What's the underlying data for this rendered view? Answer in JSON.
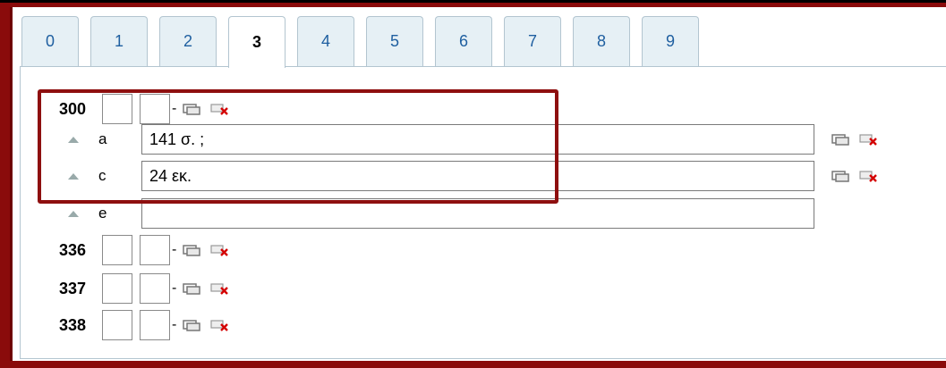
{
  "tabs": [
    {
      "label": "0"
    },
    {
      "label": "1"
    },
    {
      "label": "2"
    },
    {
      "label": "3"
    },
    {
      "label": "4"
    },
    {
      "label": "5"
    },
    {
      "label": "6"
    },
    {
      "label": "7"
    },
    {
      "label": "8"
    },
    {
      "label": "9"
    }
  ],
  "active_tab": "3",
  "fields": {
    "f300": {
      "tag": "300",
      "dash": "-"
    },
    "f336": {
      "tag": "336",
      "dash": "-"
    },
    "f337": {
      "tag": "337",
      "dash": "-"
    },
    "f338": {
      "tag": "338",
      "dash": "-"
    }
  },
  "subfields": {
    "a": {
      "code": "a",
      "value": "141 σ. ;"
    },
    "c": {
      "code": "c",
      "value": "24 εκ."
    },
    "e": {
      "code": "e",
      "value": ""
    }
  },
  "colors": {
    "frame": "#8a0b0b",
    "tab_text": "#1f5fa0",
    "highlight": "#8e0f0f",
    "delete_icon": "#d40000"
  },
  "icons": {
    "add": "add-field-icon",
    "delete": "delete-field-icon",
    "move_up": "move-up-icon"
  }
}
